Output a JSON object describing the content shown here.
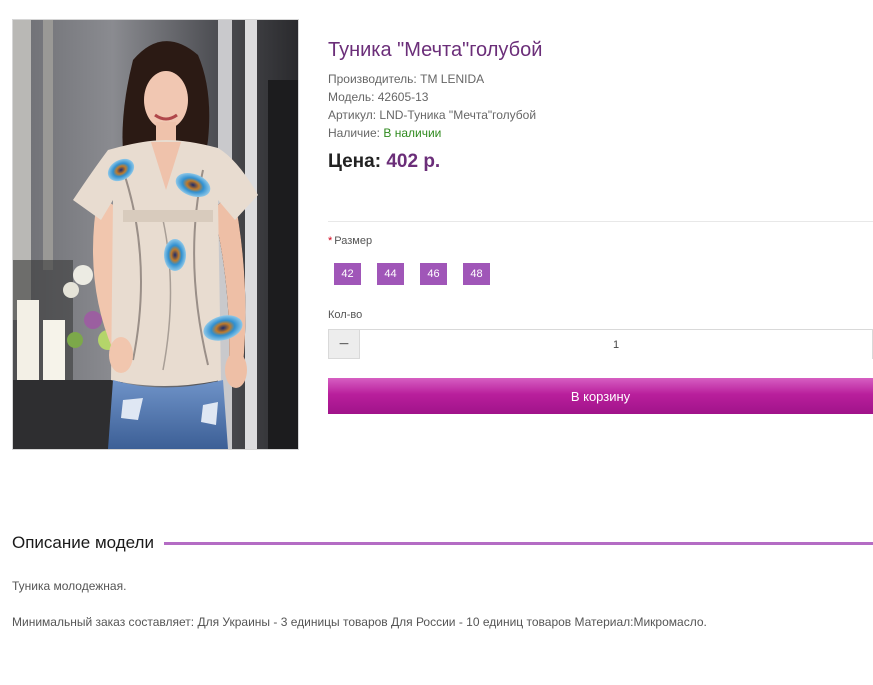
{
  "product": {
    "title": "Туника \"Мечта\"голубой",
    "manufacturer_label": "Производитель:",
    "manufacturer_value": "TM LENIDA",
    "model_label": "Модель:",
    "model_value": "42605-13",
    "sku_label": "Артикул:",
    "sku_value": "LND-Туника \"Мечта\"голубой",
    "stock_label": "Наличие:",
    "stock_value": "В наличии",
    "price_label": "Цена:",
    "price_value": "402 р."
  },
  "options": {
    "size_required_mark": "*",
    "size_label": "Размер",
    "sizes": [
      "42",
      "44",
      "46",
      "48"
    ],
    "qty_label": "Кол-во",
    "qty_minus_symbol": "−",
    "qty_value": "1",
    "cart_button_label": "В корзину"
  },
  "description": {
    "heading": "Описание модели",
    "paragraph1": "Туника молодежная.",
    "paragraph2": "Минимальный заказ составляет: Для Украины - 3 единицы товаров Для России - 10 единиц товаров Материал:Микромасло."
  },
  "colors": {
    "title": "#6b2e79",
    "accent_button": "#b91f9c",
    "size_button": "#a056b8",
    "stock": "#2f8a1e",
    "section_line": "#b46cc4"
  }
}
